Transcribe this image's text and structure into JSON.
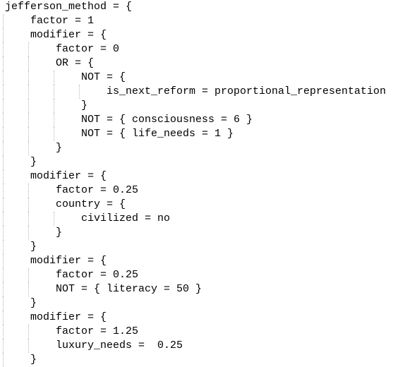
{
  "editor": {
    "lines": [
      {
        "indent": 0,
        "text": "jefferson_method = {"
      },
      {
        "indent": 1,
        "text": "factor = 1"
      },
      {
        "indent": 1,
        "text": "modifier = {"
      },
      {
        "indent": 2,
        "text": "factor = 0"
      },
      {
        "indent": 2,
        "text": "OR = {"
      },
      {
        "indent": 3,
        "text": "NOT = {"
      },
      {
        "indent": 4,
        "text": "is_next_reform = proportional_representation"
      },
      {
        "indent": 3,
        "text": "}"
      },
      {
        "indent": 3,
        "text": "NOT = { consciousness = 6 }"
      },
      {
        "indent": 3,
        "text": "NOT = { life_needs = 1 }"
      },
      {
        "indent": 2,
        "text": "}"
      },
      {
        "indent": 1,
        "text": "}"
      },
      {
        "indent": 1,
        "text": "modifier = {"
      },
      {
        "indent": 2,
        "text": "factor = 0.25"
      },
      {
        "indent": 2,
        "text": "country = {"
      },
      {
        "indent": 3,
        "text": "civilized = no"
      },
      {
        "indent": 2,
        "text": "}"
      },
      {
        "indent": 1,
        "text": "}"
      },
      {
        "indent": 1,
        "text": "modifier = {"
      },
      {
        "indent": 2,
        "text": "factor = 0.25"
      },
      {
        "indent": 2,
        "text": "NOT = { literacy = 50 }"
      },
      {
        "indent": 1,
        "text": "}"
      },
      {
        "indent": 1,
        "text": "modifier = {"
      },
      {
        "indent": 2,
        "text": "factor = 1.25"
      },
      {
        "indent": 2,
        "text": "luxury_needs =  0.25"
      },
      {
        "indent": 1,
        "text": "}"
      }
    ]
  }
}
